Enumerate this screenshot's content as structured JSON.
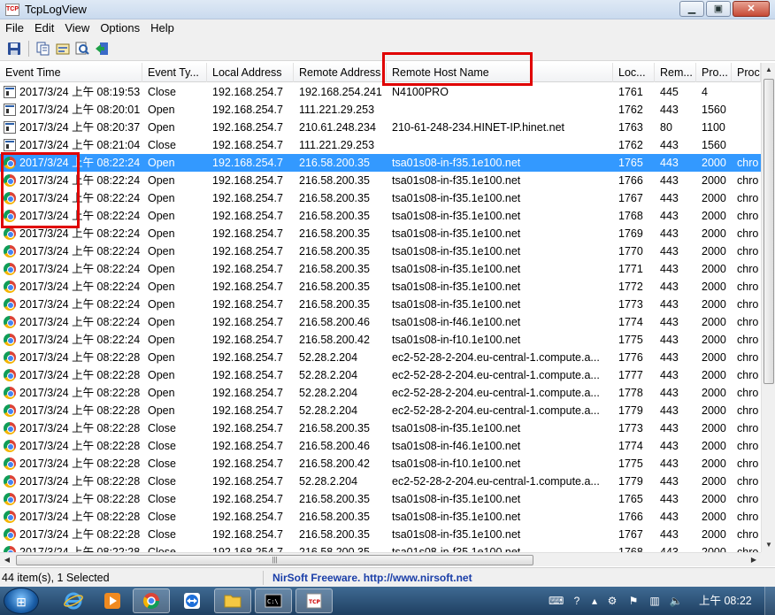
{
  "window": {
    "title": "TcpLogView",
    "icon_label": "TCP",
    "btn_minimize": "▁",
    "btn_maximize": "▣",
    "btn_close": "✕"
  },
  "menu": [
    "File",
    "Edit",
    "View",
    "Options",
    "Help"
  ],
  "toolbar": [
    "save-icon",
    "copy-icon",
    "properties-icon",
    "find-icon",
    "exit-icon"
  ],
  "columns": [
    "Event Time",
    "Event Ty...",
    "Local Address",
    "Remote Address",
    "Remote Host Name",
    "Loc...",
    "Rem...",
    "Pro...",
    "Proc"
  ],
  "rows": [
    {
      "icon": "console-icon",
      "time": "2017/3/24 上午 08:19:53",
      "type": "Close",
      "local": "192.168.254.7",
      "remote": "192.168.254.241",
      "host": "N4100PRO",
      "lport": "1761",
      "rport": "445",
      "pid": "4",
      "proc": ""
    },
    {
      "icon": "console-icon",
      "time": "2017/3/24 上午 08:20:01",
      "type": "Open",
      "local": "192.168.254.7",
      "remote": "111.221.29.253",
      "host": "",
      "lport": "1762",
      "rport": "443",
      "pid": "1560",
      "proc": ""
    },
    {
      "icon": "console-icon",
      "time": "2017/3/24 上午 08:20:37",
      "type": "Open",
      "local": "192.168.254.7",
      "remote": "210.61.248.234",
      "host": "210-61-248-234.HINET-IP.hinet.net",
      "lport": "1763",
      "rport": "80",
      "pid": "1100",
      "proc": ""
    },
    {
      "icon": "console-icon",
      "time": "2017/3/24 上午 08:21:04",
      "type": "Close",
      "local": "192.168.254.7",
      "remote": "111.221.29.253",
      "host": "",
      "lport": "1762",
      "rport": "443",
      "pid": "1560",
      "proc": ""
    },
    {
      "icon": "chrome-icon",
      "time": "2017/3/24 上午 08:22:24",
      "type": "Open",
      "local": "192.168.254.7",
      "remote": "216.58.200.35",
      "host": "tsa01s08-in-f35.1e100.net",
      "lport": "1765",
      "rport": "443",
      "pid": "2000",
      "proc": "chro"
    },
    {
      "icon": "chrome-icon",
      "time": "2017/3/24 上午 08:22:24",
      "type": "Open",
      "local": "192.168.254.7",
      "remote": "216.58.200.35",
      "host": "tsa01s08-in-f35.1e100.net",
      "lport": "1766",
      "rport": "443",
      "pid": "2000",
      "proc": "chro"
    },
    {
      "icon": "chrome-icon",
      "time": "2017/3/24 上午 08:22:24",
      "type": "Open",
      "local": "192.168.254.7",
      "remote": "216.58.200.35",
      "host": "tsa01s08-in-f35.1e100.net",
      "lport": "1767",
      "rport": "443",
      "pid": "2000",
      "proc": "chro"
    },
    {
      "icon": "chrome-icon",
      "time": "2017/3/24 上午 08:22:24",
      "type": "Open",
      "local": "192.168.254.7",
      "remote": "216.58.200.35",
      "host": "tsa01s08-in-f35.1e100.net",
      "lport": "1768",
      "rport": "443",
      "pid": "2000",
      "proc": "chro"
    },
    {
      "icon": "chrome-icon",
      "time": "2017/3/24 上午 08:22:24",
      "type": "Open",
      "local": "192.168.254.7",
      "remote": "216.58.200.35",
      "host": "tsa01s08-in-f35.1e100.net",
      "lport": "1769",
      "rport": "443",
      "pid": "2000",
      "proc": "chro"
    },
    {
      "icon": "chrome-icon",
      "time": "2017/3/24 上午 08:22:24",
      "type": "Open",
      "local": "192.168.254.7",
      "remote": "216.58.200.35",
      "host": "tsa01s08-in-f35.1e100.net",
      "lport": "1770",
      "rport": "443",
      "pid": "2000",
      "proc": "chro"
    },
    {
      "icon": "chrome-icon",
      "time": "2017/3/24 上午 08:22:24",
      "type": "Open",
      "local": "192.168.254.7",
      "remote": "216.58.200.35",
      "host": "tsa01s08-in-f35.1e100.net",
      "lport": "1771",
      "rport": "443",
      "pid": "2000",
      "proc": "chro"
    },
    {
      "icon": "chrome-icon",
      "time": "2017/3/24 上午 08:22:24",
      "type": "Open",
      "local": "192.168.254.7",
      "remote": "216.58.200.35",
      "host": "tsa01s08-in-f35.1e100.net",
      "lport": "1772",
      "rport": "443",
      "pid": "2000",
      "proc": "chro"
    },
    {
      "icon": "chrome-icon",
      "time": "2017/3/24 上午 08:22:24",
      "type": "Open",
      "local": "192.168.254.7",
      "remote": "216.58.200.35",
      "host": "tsa01s08-in-f35.1e100.net",
      "lport": "1773",
      "rport": "443",
      "pid": "2000",
      "proc": "chro"
    },
    {
      "icon": "chrome-icon",
      "time": "2017/3/24 上午 08:22:24",
      "type": "Open",
      "local": "192.168.254.7",
      "remote": "216.58.200.46",
      "host": "tsa01s08-in-f46.1e100.net",
      "lport": "1774",
      "rport": "443",
      "pid": "2000",
      "proc": "chro"
    },
    {
      "icon": "chrome-icon",
      "time": "2017/3/24 上午 08:22:24",
      "type": "Open",
      "local": "192.168.254.7",
      "remote": "216.58.200.42",
      "host": "tsa01s08-in-f10.1e100.net",
      "lport": "1775",
      "rport": "443",
      "pid": "2000",
      "proc": "chro"
    },
    {
      "icon": "chrome-icon",
      "time": "2017/3/24 上午 08:22:28",
      "type": "Open",
      "local": "192.168.254.7",
      "remote": "52.28.2.204",
      "host": "ec2-52-28-2-204.eu-central-1.compute.a...",
      "lport": "1776",
      "rport": "443",
      "pid": "2000",
      "proc": "chro"
    },
    {
      "icon": "chrome-icon",
      "time": "2017/3/24 上午 08:22:28",
      "type": "Open",
      "local": "192.168.254.7",
      "remote": "52.28.2.204",
      "host": "ec2-52-28-2-204.eu-central-1.compute.a...",
      "lport": "1777",
      "rport": "443",
      "pid": "2000",
      "proc": "chro"
    },
    {
      "icon": "chrome-icon",
      "time": "2017/3/24 上午 08:22:28",
      "type": "Open",
      "local": "192.168.254.7",
      "remote": "52.28.2.204",
      "host": "ec2-52-28-2-204.eu-central-1.compute.a...",
      "lport": "1778",
      "rport": "443",
      "pid": "2000",
      "proc": "chro"
    },
    {
      "icon": "chrome-icon",
      "time": "2017/3/24 上午 08:22:28",
      "type": "Open",
      "local": "192.168.254.7",
      "remote": "52.28.2.204",
      "host": "ec2-52-28-2-204.eu-central-1.compute.a...",
      "lport": "1779",
      "rport": "443",
      "pid": "2000",
      "proc": "chro"
    },
    {
      "icon": "chrome-icon",
      "time": "2017/3/24 上午 08:22:28",
      "type": "Close",
      "local": "192.168.254.7",
      "remote": "216.58.200.35",
      "host": "tsa01s08-in-f35.1e100.net",
      "lport": "1773",
      "rport": "443",
      "pid": "2000",
      "proc": "chro"
    },
    {
      "icon": "chrome-icon",
      "time": "2017/3/24 上午 08:22:28",
      "type": "Close",
      "local": "192.168.254.7",
      "remote": "216.58.200.46",
      "host": "tsa01s08-in-f46.1e100.net",
      "lport": "1774",
      "rport": "443",
      "pid": "2000",
      "proc": "chro"
    },
    {
      "icon": "chrome-icon",
      "time": "2017/3/24 上午 08:22:28",
      "type": "Close",
      "local": "192.168.254.7",
      "remote": "216.58.200.42",
      "host": "tsa01s08-in-f10.1e100.net",
      "lport": "1775",
      "rport": "443",
      "pid": "2000",
      "proc": "chro"
    },
    {
      "icon": "chrome-icon",
      "time": "2017/3/24 上午 08:22:28",
      "type": "Close",
      "local": "192.168.254.7",
      "remote": "52.28.2.204",
      "host": "ec2-52-28-2-204.eu-central-1.compute.a...",
      "lport": "1779",
      "rport": "443",
      "pid": "2000",
      "proc": "chro"
    },
    {
      "icon": "chrome-icon",
      "time": "2017/3/24 上午 08:22:28",
      "type": "Close",
      "local": "192.168.254.7",
      "remote": "216.58.200.35",
      "host": "tsa01s08-in-f35.1e100.net",
      "lport": "1765",
      "rport": "443",
      "pid": "2000",
      "proc": "chro"
    },
    {
      "icon": "chrome-icon",
      "time": "2017/3/24 上午 08:22:28",
      "type": "Close",
      "local": "192.168.254.7",
      "remote": "216.58.200.35",
      "host": "tsa01s08-in-f35.1e100.net",
      "lport": "1766",
      "rport": "443",
      "pid": "2000",
      "proc": "chro"
    },
    {
      "icon": "chrome-icon",
      "time": "2017/3/24 上午 08:22:28",
      "type": "Close",
      "local": "192.168.254.7",
      "remote": "216.58.200.35",
      "host": "tsa01s08-in-f35.1e100.net",
      "lport": "1767",
      "rport": "443",
      "pid": "2000",
      "proc": "chro"
    },
    {
      "icon": "chrome-icon",
      "time": "2017/3/24 上午 08:22:28",
      "type": "Close",
      "local": "192.168.254.7",
      "remote": "216.58.200.35",
      "host": "tsa01s08-in-f35.1e100.net",
      "lport": "1768",
      "rport": "443",
      "pid": "2000",
      "proc": "chro"
    }
  ],
  "selected_row": 4,
  "status": {
    "count": "44 item(s), 1 Selected",
    "credit": "NirSoft Freeware.  http://www.nirsoft.net"
  },
  "taskbar": {
    "start_icon": "windows-start-icon",
    "apps": [
      "internet-explorer-icon",
      "media-player-icon",
      "chrome-icon",
      "teamviewer-icon",
      "file-explorer-icon",
      "command-prompt-icon",
      "tcplogview-icon"
    ],
    "clock": "上午 08:22"
  },
  "colors": {
    "selection": "#3399ff",
    "highlight_box": "#e00000",
    "taskbar": "#2a5078",
    "link": "#1a3ea8"
  }
}
